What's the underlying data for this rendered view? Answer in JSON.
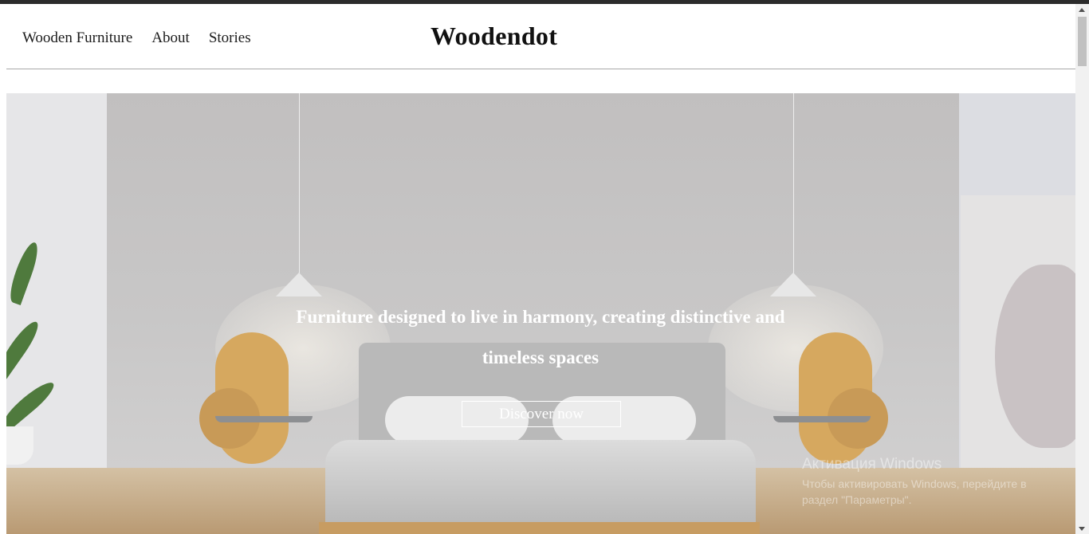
{
  "nav": {
    "items": [
      {
        "label": "Wooden Furniture"
      },
      {
        "label": "About"
      },
      {
        "label": "Stories"
      }
    ]
  },
  "brand": {
    "logo": "Woodendot"
  },
  "hero": {
    "headline": "Furniture designed to live in harmony, creating distinctive and timeless spaces",
    "cta_label": "Discover now"
  },
  "watermark": {
    "title": "Активация Windows",
    "subtitle": "Чтобы активировать Windows, перейдите в раздел \"Параметры\"."
  },
  "colors": {
    "text": "#1b1b1b",
    "hero_text": "#ffffff",
    "divider": "#a9a9a9"
  }
}
